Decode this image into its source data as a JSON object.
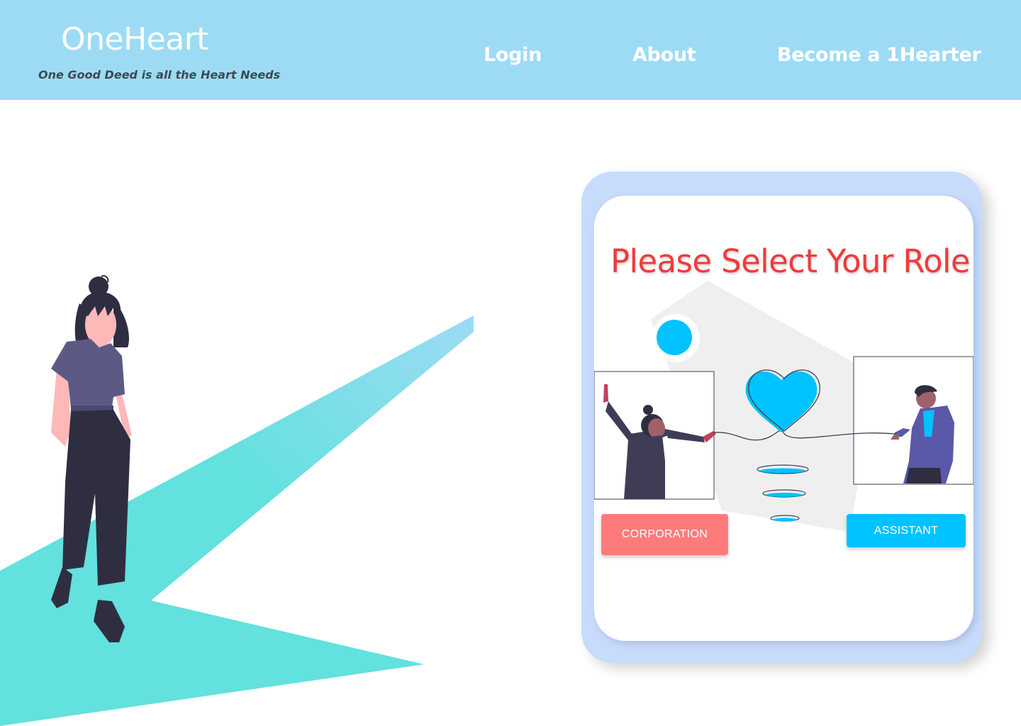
{
  "header": {
    "logo": "OneHeart",
    "tagline": "One Good Deed is all the Heart Needs",
    "nav": {
      "login": "Login",
      "about": "About",
      "become": "Become a 1Hearter"
    }
  },
  "role_card": {
    "title": "Please Select Your Role",
    "corporation_label": "CORPORATION",
    "assistant_label": "ASSISTANT"
  },
  "colors": {
    "header_bg": "#9ddbf5",
    "title": "#ef3b3b",
    "corporation_button": "#ff7b7b",
    "assistant_button": "#00c2ff",
    "card_frame": "#c7dbfb"
  },
  "icons": {
    "heart": "heart-icon"
  }
}
